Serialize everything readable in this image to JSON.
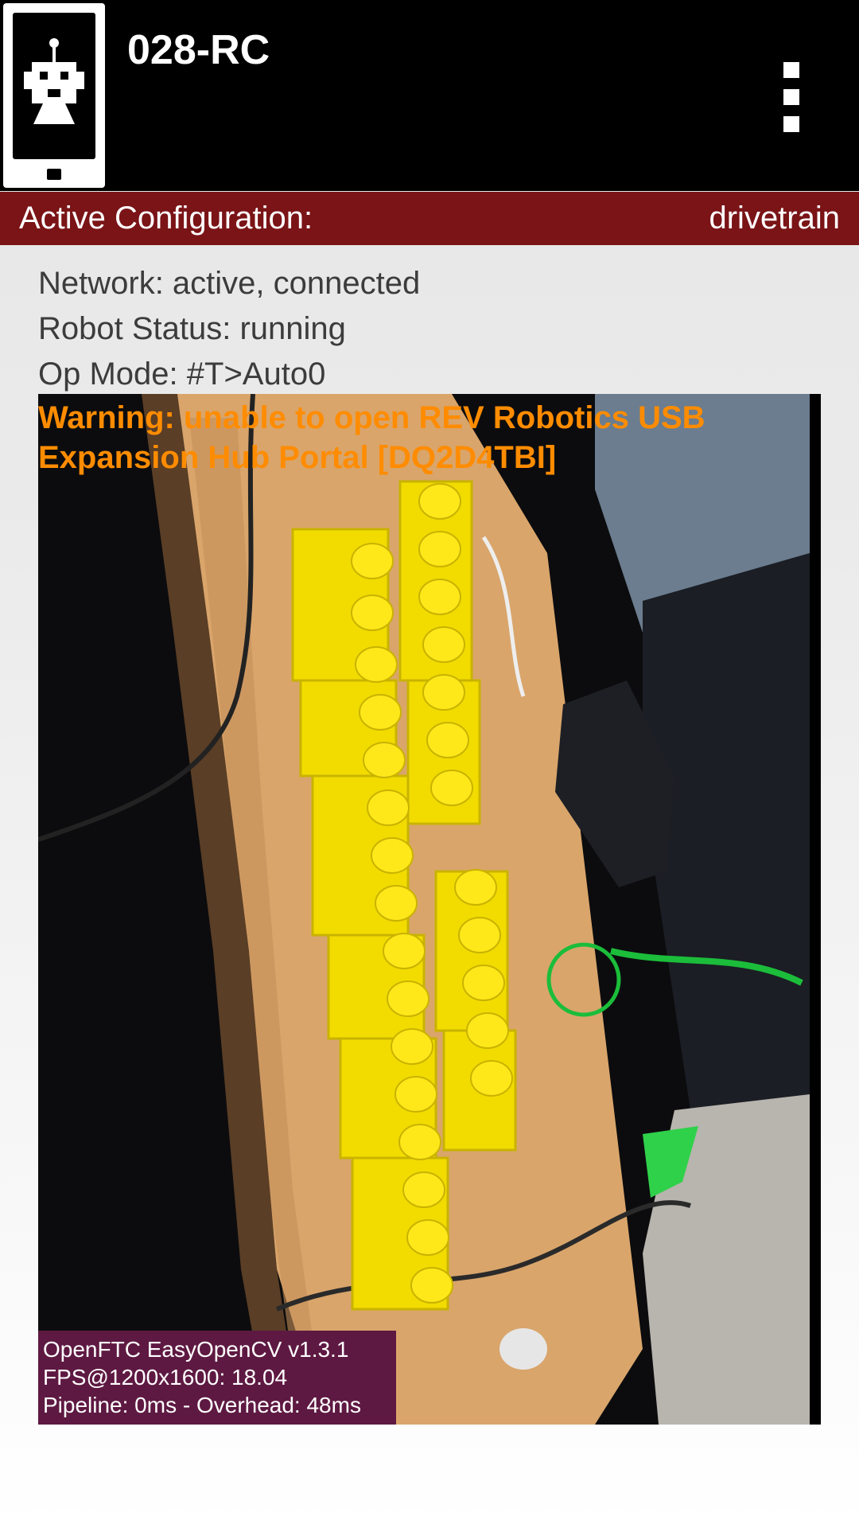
{
  "app_bar": {
    "title": "028-RC",
    "icon": "robot-controller-icon",
    "menu_icon": "overflow-menu-icon"
  },
  "config_bar": {
    "label": "Active Configuration:",
    "value": "drivetrain"
  },
  "status": {
    "network": "Network: active, connected",
    "robot": "Robot Status: running",
    "op_mode": "Op Mode: #T>Auto0"
  },
  "warning": "Warning: unable to open REV Robotics USB Expansion Hub Portal [DQ2D4TBI]",
  "camera_overlay": {
    "line1": "OpenFTC EasyOpenCV v1.3.1",
    "line2": "FPS@1200x1600: 18.04",
    "line3": "Pipeline: 0ms - Overhead: 48ms"
  },
  "colors": {
    "app_bar_bg": "#000000",
    "config_bar_bg": "#7a1417",
    "warning_text": "#ff8c00",
    "overlay_bg": "#5e1942",
    "brick_yellow": "#f2dc00",
    "desk_wood": "#d9a56b"
  }
}
